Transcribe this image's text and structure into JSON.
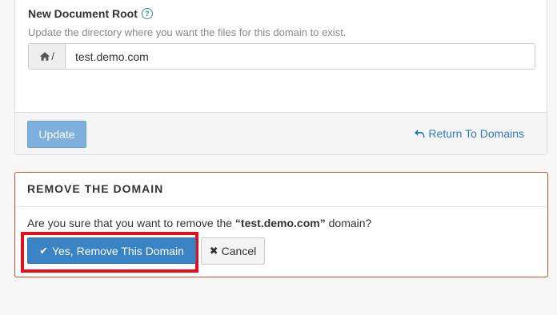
{
  "doc_root": {
    "label": "New Document Root",
    "help_icon": "question-circle-icon",
    "hint": "Update the directory where you want the files for this domain to exist.",
    "prefix_icon": "home-icon",
    "prefix_slash": "/",
    "value": "test.demo.com"
  },
  "footer": {
    "update_label": "Update",
    "return_icon": "return-arrow-icon",
    "return_label": "Return To Domains"
  },
  "remove": {
    "heading": "REMOVE THE DOMAIN",
    "question_before": "Are you sure that you want to remove the ",
    "domain": "“test.demo.com”",
    "question_after": " domain?",
    "confirm_icon": "check-icon",
    "confirm_label": "Yes, Remove This Domain",
    "cancel_icon": "times-icon",
    "cancel_label": "Cancel"
  },
  "colors": {
    "primary": "#3a83c4",
    "primary_disabled": "#7fb0dd",
    "danger_border": "#c0532a",
    "highlight": "#e3101c",
    "link": "#2e7bbf"
  }
}
